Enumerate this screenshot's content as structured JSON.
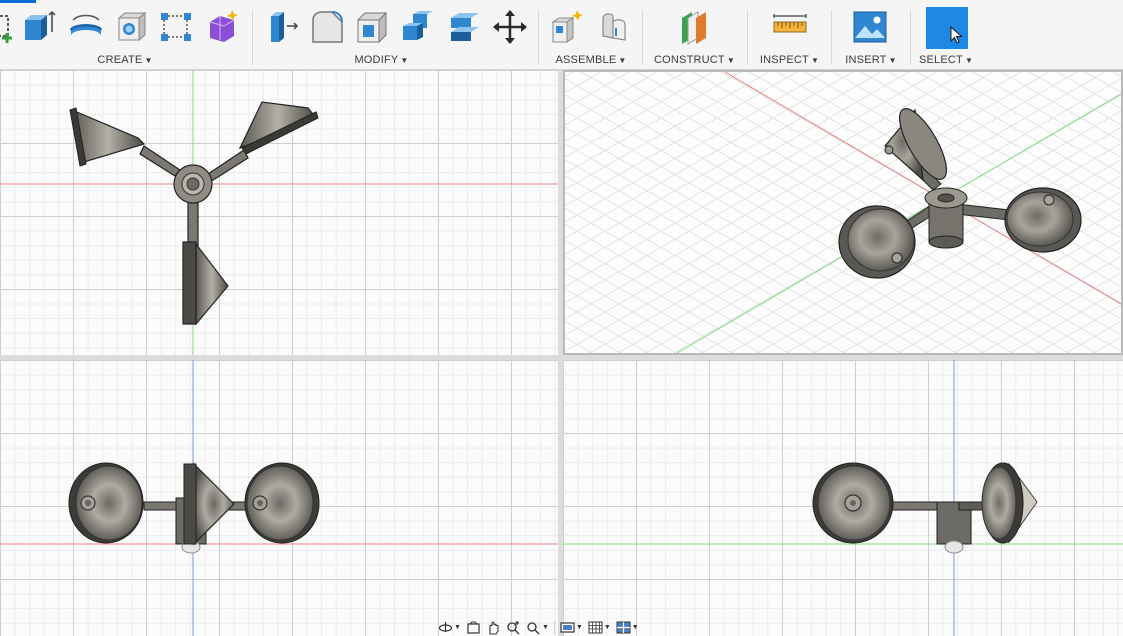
{
  "toolbar": {
    "groups": [
      {
        "label": "CREATE"
      },
      {
        "label": "MODIFY"
      },
      {
        "label": "ASSEMBLE"
      },
      {
        "label": "CONSTRUCT"
      },
      {
        "label": "INSPECT"
      },
      {
        "label": "INSERT"
      },
      {
        "label": "SELECT"
      }
    ],
    "icons": {
      "create": [
        "sketch-icon",
        "extrude-icon",
        "revolve-icon",
        "hole-icon",
        "pattern-icon",
        "form-icon"
      ],
      "modify": [
        "press-pull-icon",
        "fillet-icon",
        "shell-icon",
        "combine-icon",
        "offset-face-icon",
        "move-icon"
      ],
      "assemble": [
        "new-component-icon",
        "joint-icon"
      ],
      "construct": [
        "offset-plane-icon"
      ],
      "inspect": [
        "measure-icon"
      ],
      "insert": [
        "insert-image-icon"
      ],
      "select": [
        "select-cursor-icon"
      ]
    },
    "colors": {
      "accent": "#0a6fd6",
      "select_bg": "#1e88e5",
      "create_green": "#2e9e3a",
      "construct_orange": "#e07a2c"
    }
  },
  "viewports": {
    "top": {
      "name": "top-view"
    },
    "iso": {
      "name": "isometric-view"
    },
    "front": {
      "name": "front-view"
    },
    "right": {
      "name": "right-view"
    },
    "axis_colors": {
      "x": "#e05a5a",
      "y": "#6fd66f",
      "z": "#6a8fe8"
    }
  },
  "navbar": {
    "icons": [
      "orbit-icon",
      "look-at-icon",
      "pan-icon",
      "zoom-icon",
      "fit-icon",
      "display-settings-icon",
      "grid-settings-icon",
      "viewports-icon"
    ]
  }
}
